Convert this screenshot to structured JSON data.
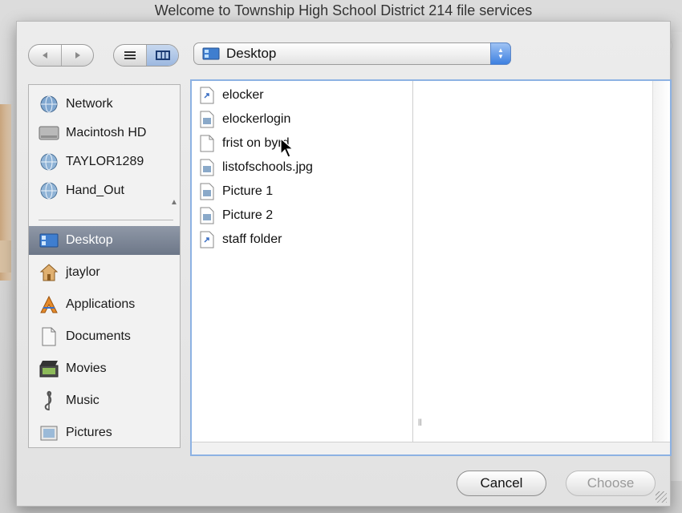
{
  "sheet": {
    "title": "Welcome to Township High School District 214 file services"
  },
  "toolbar": {
    "back_icon": "back-arrow-icon",
    "forward_icon": "forward-arrow-icon",
    "list_view_icon": "list-view-icon",
    "column_view_icon": "column-view-icon",
    "path": "Desktop"
  },
  "sidebar": {
    "devices": [
      {
        "label": "Network",
        "icon": "network-globe-icon"
      },
      {
        "label": "Macintosh HD",
        "icon": "hard-drive-icon"
      },
      {
        "label": "TAYLOR1289",
        "icon": "server-globe-icon"
      },
      {
        "label": "Hand_Out",
        "icon": "server-globe-icon"
      }
    ],
    "places": [
      {
        "label": "Desktop",
        "icon": "desktop-icon",
        "selected": true
      },
      {
        "label": "jtaylor",
        "icon": "home-icon"
      },
      {
        "label": "Applications",
        "icon": "applications-icon"
      },
      {
        "label": "Documents",
        "icon": "documents-icon"
      },
      {
        "label": "Movies",
        "icon": "movies-icon"
      },
      {
        "label": "Music",
        "icon": "music-icon"
      },
      {
        "label": "Pictures",
        "icon": "pictures-icon"
      }
    ]
  },
  "files": [
    {
      "name": "elocker",
      "icon": "alias-document-icon"
    },
    {
      "name": "elockerlogin",
      "icon": "image-document-icon"
    },
    {
      "name": "frist on byrd",
      "icon": "blank-document-icon"
    },
    {
      "name": "listofschools.jpg",
      "icon": "image-document-icon"
    },
    {
      "name": "Picture 1",
      "icon": "image-document-icon"
    },
    {
      "name": "Picture 2",
      "icon": "image-document-icon"
    },
    {
      "name": "staff folder",
      "icon": "alias-document-icon"
    }
  ],
  "buttons": {
    "cancel": "Cancel",
    "choose": "Choose"
  },
  "colors": {
    "selection": "#7a8496",
    "focus_ring": "#8db2e3",
    "popup_arrow": "#3d7fe0"
  }
}
